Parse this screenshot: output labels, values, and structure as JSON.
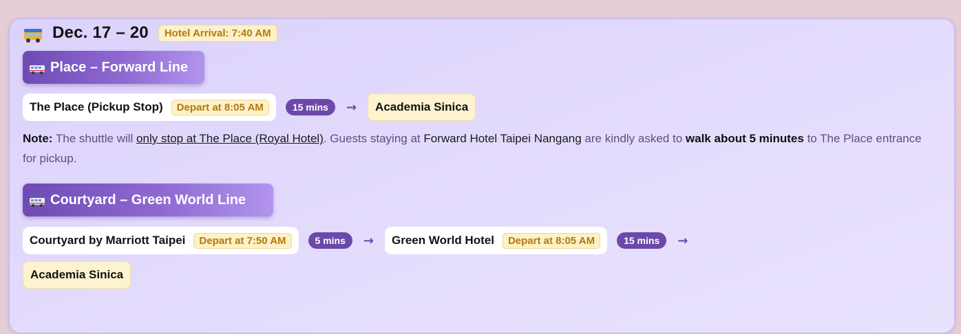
{
  "header": {
    "icon": "bus-icon",
    "date_range": "Dec. 17 – 20",
    "arrival_badge": "Hotel Arrival: 7:40 AM"
  },
  "lines": {
    "forward": {
      "icon": "bus-icon",
      "title": "Place – Forward Line",
      "stops": [
        {
          "name": "The Place (Pickup Stop)",
          "depart": "Depart at 8:05 AM"
        }
      ],
      "durations": [
        "15 mins"
      ],
      "destination": "Academia Sinica"
    },
    "courtyard": {
      "icon": "bus-icon",
      "title": "Courtyard – Green World Line",
      "stops": [
        {
          "name": "Courtyard by Marriott Taipei",
          "depart": "Depart at 7:50 AM"
        },
        {
          "name": "Green World Hotel",
          "depart": "Depart at 8:05 AM"
        }
      ],
      "durations": [
        "5 mins",
        "15 mins"
      ],
      "destination": "Academia Sinica"
    }
  },
  "note": {
    "label": "Note:",
    "part1": " The shuttle will ",
    "only_stop": "only stop at The Place (Royal Hotel)",
    "part2": ". Guests staying at ",
    "hotel": "Forward Hotel Taipei Nangang",
    "part3": " are kindly asked to ",
    "walk": "walk about 5 minutes",
    "part4": " to The Place entrance for pickup."
  },
  "arrow_glyph": "→",
  "colors": {
    "accent": "#6a49a8",
    "badge_bg": "#fdf1c9",
    "badge_text": "#b5780b",
    "card_bg": "#e1d8fc"
  }
}
